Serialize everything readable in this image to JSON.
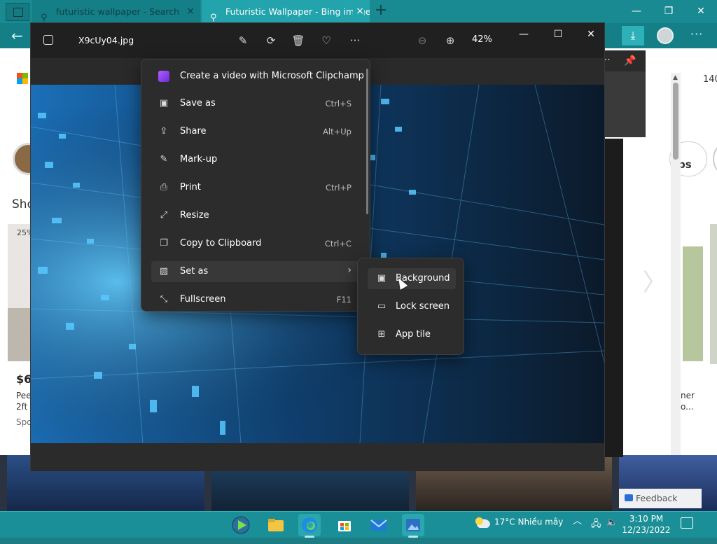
{
  "browser": {
    "tabs": [
      {
        "label": "futuristic wallpaper - Search"
      },
      {
        "label": "Futuristic Wallpaper - Bing images"
      }
    ],
    "page": {
      "result_count": "140",
      "left_badge": "25%",
      "left_heading": "Sho",
      "left_price": "$6",
      "left_line_2": "Pee",
      "left_line_3": "2ft",
      "left_line_4": "Spo",
      "right_line_1": "ner",
      "right_line_2": "o...",
      "pill_text": "ps"
    },
    "feedback_label": "Feedback"
  },
  "photos": {
    "filename": "X9cUy04.jpg",
    "zoom": "42%"
  },
  "context_menu": {
    "items": [
      {
        "label": "Create a video with Microsoft Clipchamp",
        "shortcut": ""
      },
      {
        "label": "Save as",
        "shortcut": "Ctrl+S"
      },
      {
        "label": "Share",
        "shortcut": "Alt+Up"
      },
      {
        "label": "Mark-up",
        "shortcut": ""
      },
      {
        "label": "Print",
        "shortcut": "Ctrl+P"
      },
      {
        "label": "Resize",
        "shortcut": ""
      },
      {
        "label": "Copy to Clipboard",
        "shortcut": "Ctrl+C"
      },
      {
        "label": "Set as",
        "shortcut": ""
      },
      {
        "label": "Fullscreen",
        "shortcut": "F11"
      }
    ]
  },
  "submenu": {
    "items": [
      {
        "label": "Background"
      },
      {
        "label": "Lock screen"
      },
      {
        "label": "App tile"
      }
    ]
  },
  "taskbar": {
    "weather": "17°C  Nhiều mây",
    "time": "3:10 PM",
    "date": "12/23/2022"
  },
  "colors": {
    "taskbar": "#1b8f97",
    "menu_bg": "#2c2c2c",
    "photos_bg": "#202020",
    "accent_tab": "#23a3ab"
  }
}
